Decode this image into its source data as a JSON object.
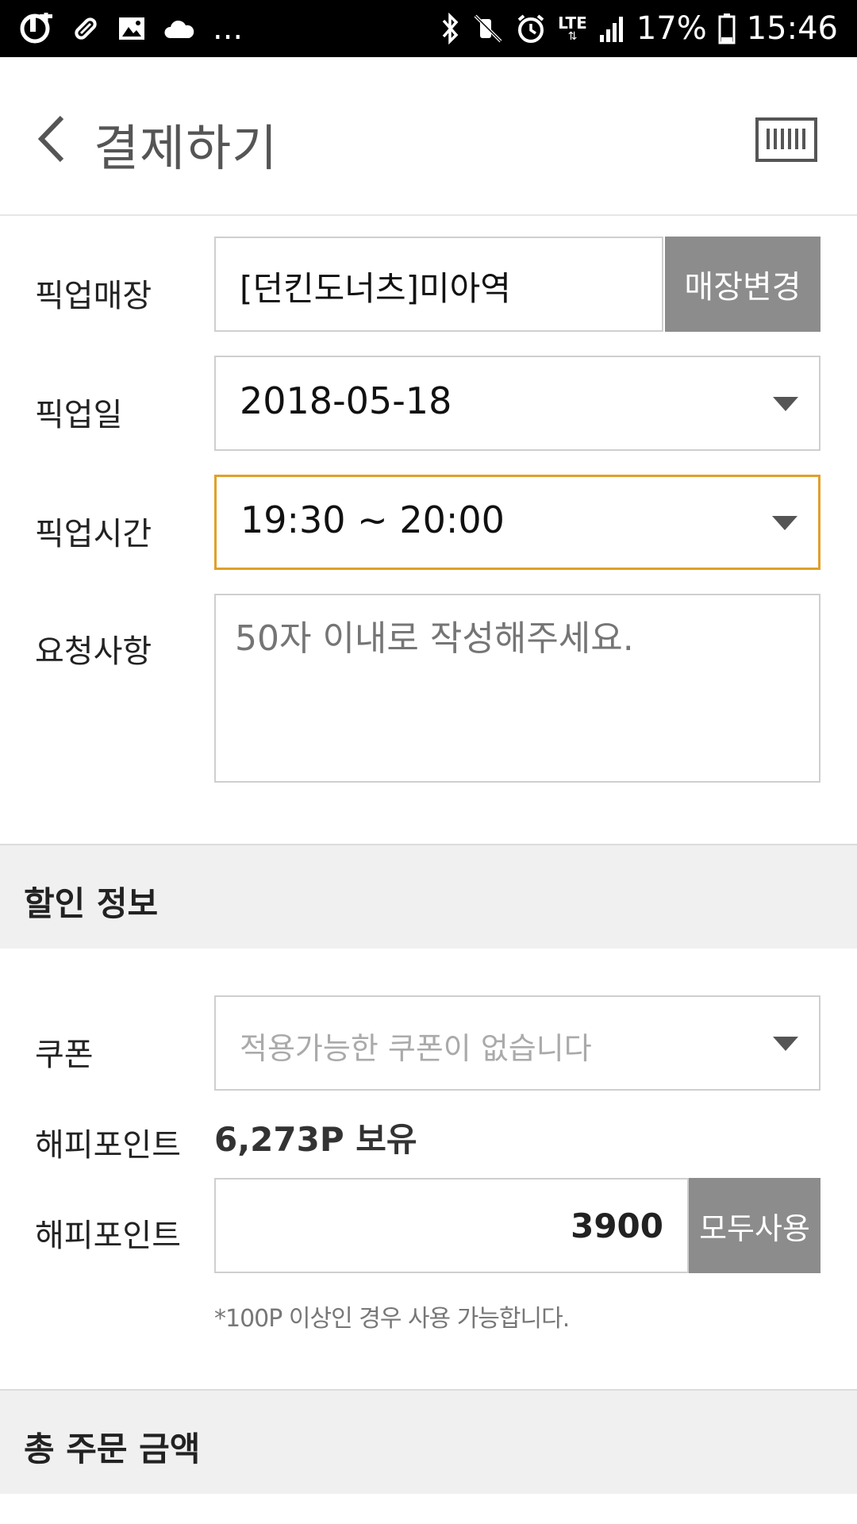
{
  "status_bar": {
    "overflow": "...",
    "lte": "LTE",
    "battery": "17%",
    "time": "15:46",
    "icons": [
      "u-plus-icon",
      "pill-icon",
      "image-icon",
      "cloud-icon",
      "bluetooth-icon",
      "mute-icon",
      "alarm-icon",
      "lte-icon",
      "signal-icon",
      "battery-icon"
    ]
  },
  "header": {
    "title": "결제하기",
    "back_icon": "chevron-left-icon",
    "barcode_icon": "barcode-icon"
  },
  "pickup": {
    "store_label": "픽업매장",
    "store_value": "[던킨도너츠]미아역",
    "change_store_button": "매장변경",
    "date_label": "픽업일",
    "date_value": "2018-05-18",
    "time_label": "픽업시간",
    "time_value": "19:30 ~ 20:00",
    "request_label": "요청사항",
    "request_placeholder": "50자 이내로 작성해주세요."
  },
  "discount": {
    "section_title": "할인 정보",
    "coupon_label": "쿠폰",
    "coupon_placeholder": "적용가능한 쿠폰이 없습니다",
    "points_label": "해피포인트",
    "points_balance": "6,273P 보유",
    "points_input_label": "해피포인트",
    "points_input_value": "3900",
    "use_all_button": "모두사용",
    "points_note": "*100P 이상인 경우 사용 가능합니다."
  },
  "total": {
    "section_title": "총 주문 금액"
  },
  "colors": {
    "accent_border": "#e0a02a",
    "button_gray": "#8c8c8c",
    "section_bg": "#f0f0f0"
  }
}
